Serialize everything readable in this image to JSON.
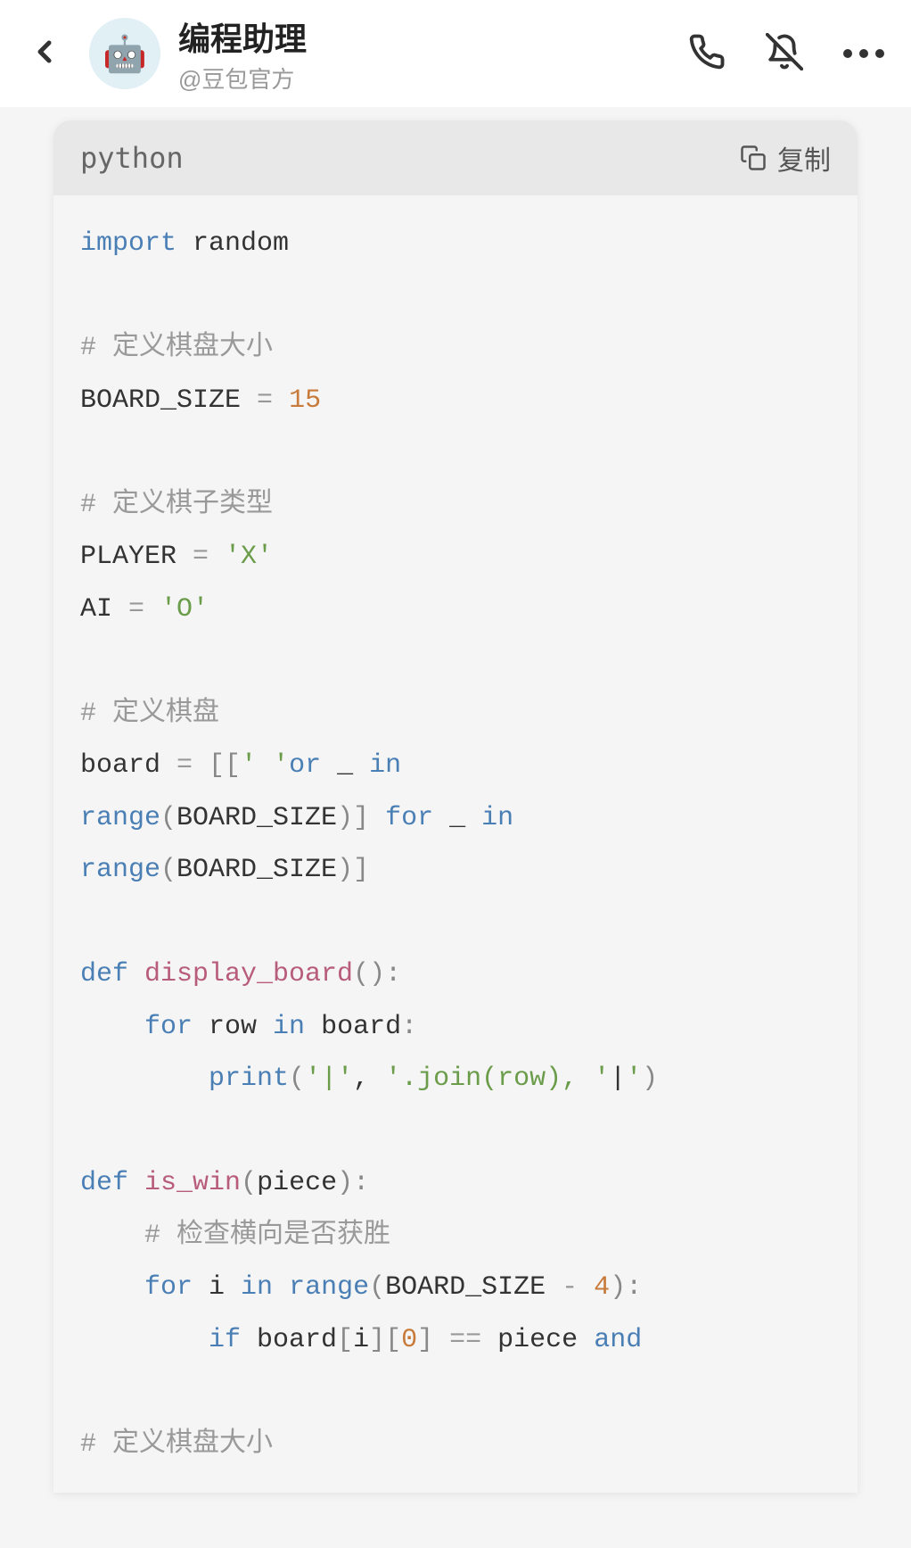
{
  "header": {
    "title": "编程助理",
    "subtitle": "@豆包官方",
    "avatar_emoji": "🤖"
  },
  "code_block": {
    "language": "python",
    "copy_label": "复制",
    "lines": {
      "l1_import": "import",
      "l1_random": " random",
      "l3_cmt": "# 定义棋盘大小",
      "l4_var": "BOARD_SIZE ",
      "l4_eq": "= ",
      "l4_num": "15",
      "l6_cmt": "# 定义棋子类型",
      "l7_var": "PLAYER ",
      "l7_eq": "= ",
      "l7_str": "'X'",
      "l8_var": "AI ",
      "l8_eq": "= ",
      "l8_str": "'O'",
      "l10_cmt": "# 定义棋盘",
      "l11_var": "board ",
      "l11_eq": "= ",
      "l11_br1": "[[",
      "l11_str": "' '",
      "l11_or": "or",
      "l11_u": " _ ",
      "l11_in": "in",
      "l12_range": "range",
      "l12_p1": "(",
      "l12_var": "BOARD_SIZE",
      "l12_p2": ")]",
      "l12_for": " for",
      "l12_u": " _ ",
      "l12_in": "in",
      "l13_range": "range",
      "l13_p1": "(",
      "l13_var": "BOARD_SIZE",
      "l13_p2": ")]",
      "l15_def": "def ",
      "l15_fn": "display_board",
      "l15_p": "():",
      "l16_for": "for",
      "l16_mid": " row ",
      "l16_in": "in",
      "l16_end": " board",
      "l16_colon": ":",
      "l17_print": "print",
      "l17_p1": "(",
      "l17_s1": "'|'",
      "l17_c1": ", ",
      "l17_s2": "'.join(row), '",
      "l17_c2": "|",
      "l17_s3": "'",
      "l17_p2": ")",
      "l19_def": "def ",
      "l19_fn": "is_win",
      "l19_p1": "(",
      "l19_arg": "piece",
      "l19_p2": "):",
      "l20_cmt": "# 检查横向是否获胜",
      "l21_for": "for",
      "l21_i": " i ",
      "l21_in": "in",
      "l21_sp": " ",
      "l21_range": "range",
      "l21_p1": "(",
      "l21_var": "BOARD_SIZE ",
      "l21_op": "- ",
      "l21_num": "4",
      "l21_p2": "):",
      "l22_if": "if",
      "l22_mid1": " board",
      "l22_br1": "[",
      "l22_i": "i",
      "l22_br2": "][",
      "l22_zero": "0",
      "l22_br3": "]",
      "l22_eq": " == ",
      "l22_piece": "piece ",
      "l22_and": "and",
      "l24_cmt": "# 定义棋盘大小"
    }
  }
}
